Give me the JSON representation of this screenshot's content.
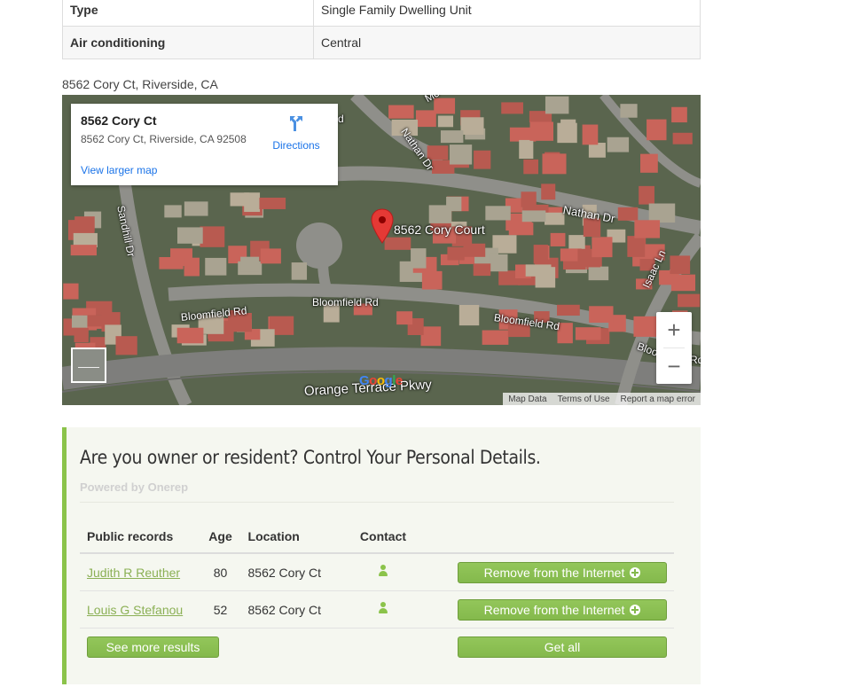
{
  "details": {
    "rows": [
      {
        "key": "Type",
        "value": "Single Family Dwelling Unit"
      },
      {
        "key": "Air conditioning",
        "value": "Central"
      }
    ]
  },
  "map": {
    "caption": "8562 Cory Ct, Riverside, CA",
    "card": {
      "name": "8562 Cory Ct",
      "full_address": "8562 Cory Ct, Riverside, CA 92508",
      "directions_label": "Directions",
      "larger_map_label": "View larger map"
    },
    "pin_label": "8562 Cory Court",
    "street_labels": {
      "nathan_dr_top": "Nathan Dr",
      "nathan_dr_right": "Nathan Dr",
      "sandhill_dr": "Sandhill Dr",
      "bloomfield_left": "Bloomfield Rd",
      "bloomfield_mid": "Bloomfield Rd",
      "bloomfield_right": "Bloomfield Rd",
      "bloomfield_edge": "Bloo",
      "isaac_ln": "Isaac Ln",
      "orange_terrace": "Orange Terrace Pkwy",
      "edge_rd": "Rd",
      "edge_mo": "Mo",
      "edge_d": "d"
    },
    "zoom_in": "+",
    "zoom_out": "−",
    "logo": [
      "G",
      "o",
      "o",
      "g",
      "l",
      "e"
    ],
    "footer": {
      "map_data": "Map Data",
      "terms": "Terms of Use",
      "report": "Report a map error"
    },
    "icons": {
      "directions": "directions-icon",
      "pin": "map-pin-icon",
      "pegman": "street-view-icon"
    },
    "colors": {
      "link": "#1a73e8",
      "pin": "#e53935"
    }
  },
  "owner": {
    "heading": "Are you owner or resident? Control Your Personal Details.",
    "powered_by": "Powered by Onerep",
    "columns": [
      "Public records",
      "Age",
      "Location",
      "Contact"
    ],
    "records": [
      {
        "name": "Judith R Reuther",
        "age": "80",
        "location": "8562 Cory Ct",
        "remove_label": "Remove from the Internet"
      },
      {
        "name": "Louis G Stefanou",
        "age": "52",
        "location": "8562 Cory Ct",
        "remove_label": "Remove from the Internet"
      }
    ],
    "see_more_label": "See more results",
    "get_all_label": "Get all",
    "colors": {
      "accent": "#8bc34a",
      "link": "#8bb055"
    }
  }
}
